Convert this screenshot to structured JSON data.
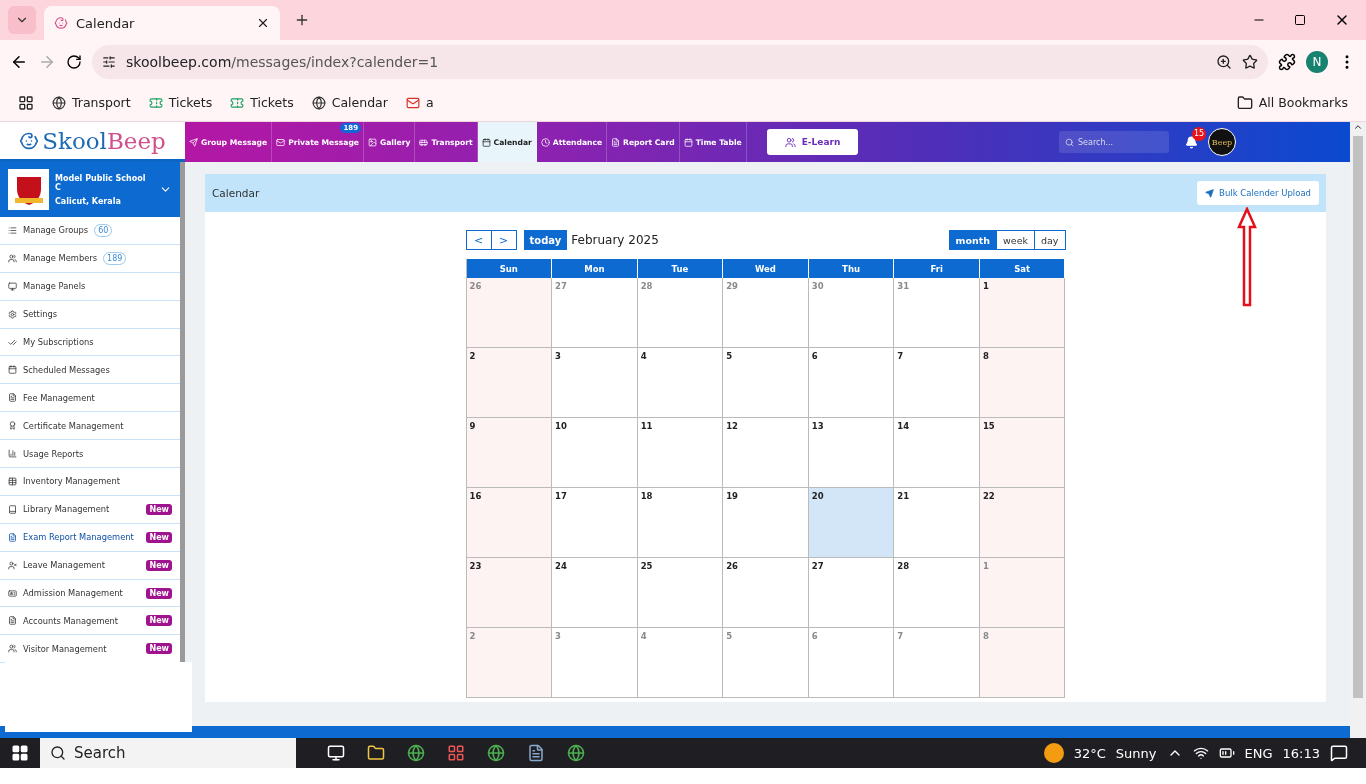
{
  "browser": {
    "tab_title": "Calendar",
    "url_host": "skoolbeep.com",
    "url_path": "/messages/index?calender=1",
    "profile_initial": "N",
    "bookmarks": [
      {
        "label": "Transport",
        "kind": "globe"
      },
      {
        "label": "Tickets",
        "kind": "ticket"
      },
      {
        "label": "Tickets",
        "kind": "ticket"
      },
      {
        "label": "Calendar",
        "kind": "globe"
      },
      {
        "label": "a",
        "kind": "mail"
      }
    ],
    "all_bookmarks": "All Bookmarks"
  },
  "app": {
    "logo_first": "Skool",
    "logo_second": "Beep",
    "nav": [
      {
        "label": "Group Message",
        "selected": false
      },
      {
        "label": "Private Message",
        "selected": false,
        "badge": "189"
      },
      {
        "label": "Gallery",
        "selected": false
      },
      {
        "label": "Transport",
        "selected": false
      },
      {
        "label": "Calendar",
        "selected": true
      },
      {
        "label": "Attendance",
        "selected": false
      },
      {
        "label": "Report Card",
        "selected": false
      },
      {
        "label": "Time Table",
        "selected": false
      }
    ],
    "elearn": "E-Learn",
    "search_placeholder": "Search...",
    "notifications": "15",
    "avatar_text": "Beep"
  },
  "sidebar": {
    "school": "Model Public School C",
    "place": "Calicut, Kerala",
    "items": [
      {
        "label": "Manage Groups",
        "count": "60",
        "selected": false
      },
      {
        "label": "Manage Members",
        "count": "189",
        "selected": false
      },
      {
        "label": "Manage Panels",
        "selected": false
      },
      {
        "label": "Settings",
        "selected": false
      },
      {
        "label": "My Subscriptions",
        "selected": false
      },
      {
        "label": "Scheduled Messages",
        "selected": false
      },
      {
        "label": "Fee Management",
        "selected": false
      },
      {
        "label": "Certificate Management",
        "selected": false
      },
      {
        "label": "Usage Reports",
        "selected": false
      },
      {
        "label": "Inventory Management",
        "selected": false
      },
      {
        "label": "Library Management",
        "tag": "New",
        "selected": false
      },
      {
        "label": "Exam Report Management",
        "tag": "New",
        "selected": true
      },
      {
        "label": "Leave Management",
        "tag": "New",
        "selected": false
      },
      {
        "label": "Admission Management",
        "tag": "New",
        "selected": false
      },
      {
        "label": "Accounts Management",
        "tag": "New",
        "selected": false
      },
      {
        "label": "Visitor Management",
        "tag": "New",
        "selected": false
      }
    ]
  },
  "page": {
    "title": "Calendar",
    "bulk_button": "Bulk Calender Upload"
  },
  "calendar": {
    "prev": "<",
    "next": ">",
    "today": "today",
    "month_title": "February 2025",
    "views": [
      {
        "label": "month",
        "selected": true
      },
      {
        "label": "week",
        "selected": false
      },
      {
        "label": "day",
        "selected": false
      }
    ],
    "weekdays": [
      "Sun",
      "Mon",
      "Tue",
      "Wed",
      "Thu",
      "Fri",
      "Sat"
    ],
    "weeks": [
      [
        {
          "day": "26",
          "other": true,
          "today": false
        },
        {
          "day": "27",
          "other": true,
          "today": false
        },
        {
          "day": "28",
          "other": true,
          "today": false
        },
        {
          "day": "29",
          "other": true,
          "today": false
        },
        {
          "day": "30",
          "other": true,
          "today": false
        },
        {
          "day": "31",
          "other": true,
          "today": false
        },
        {
          "day": "1",
          "other": false,
          "today": false
        }
      ],
      [
        {
          "day": "2",
          "other": false,
          "today": false
        },
        {
          "day": "3",
          "other": false,
          "today": false
        },
        {
          "day": "4",
          "other": false,
          "today": false
        },
        {
          "day": "5",
          "other": false,
          "today": false
        },
        {
          "day": "6",
          "other": false,
          "today": false
        },
        {
          "day": "7",
          "other": false,
          "today": false
        },
        {
          "day": "8",
          "other": false,
          "today": false
        }
      ],
      [
        {
          "day": "9",
          "other": false,
          "today": false
        },
        {
          "day": "10",
          "other": false,
          "today": false
        },
        {
          "day": "11",
          "other": false,
          "today": false
        },
        {
          "day": "12",
          "other": false,
          "today": false
        },
        {
          "day": "13",
          "other": false,
          "today": false
        },
        {
          "day": "14",
          "other": false,
          "today": false
        },
        {
          "day": "15",
          "other": false,
          "today": false
        }
      ],
      [
        {
          "day": "16",
          "other": false,
          "today": false
        },
        {
          "day": "17",
          "other": false,
          "today": false
        },
        {
          "day": "18",
          "other": false,
          "today": false
        },
        {
          "day": "19",
          "other": false,
          "today": false
        },
        {
          "day": "20",
          "other": false,
          "today": true
        },
        {
          "day": "21",
          "other": false,
          "today": false
        },
        {
          "day": "22",
          "other": false,
          "today": false
        }
      ],
      [
        {
          "day": "23",
          "other": false,
          "today": false
        },
        {
          "day": "24",
          "other": false,
          "today": false
        },
        {
          "day": "25",
          "other": false,
          "today": false
        },
        {
          "day": "26",
          "other": false,
          "today": false
        },
        {
          "day": "27",
          "other": false,
          "today": false
        },
        {
          "day": "28",
          "other": false,
          "today": false
        },
        {
          "day": "1",
          "other": true,
          "today": false
        }
      ],
      [
        {
          "day": "2",
          "other": true,
          "today": false
        },
        {
          "day": "3",
          "other": true,
          "today": false
        },
        {
          "day": "4",
          "other": true,
          "today": false
        },
        {
          "day": "5",
          "other": true,
          "today": false
        },
        {
          "day": "6",
          "other": true,
          "today": false
        },
        {
          "day": "7",
          "other": true,
          "today": false
        },
        {
          "day": "8",
          "other": true,
          "today": false
        }
      ]
    ]
  },
  "taskbar": {
    "search": "Search",
    "temperature": "32°C",
    "weather": "Sunny",
    "language": "ENG",
    "time": "16:13"
  }
}
